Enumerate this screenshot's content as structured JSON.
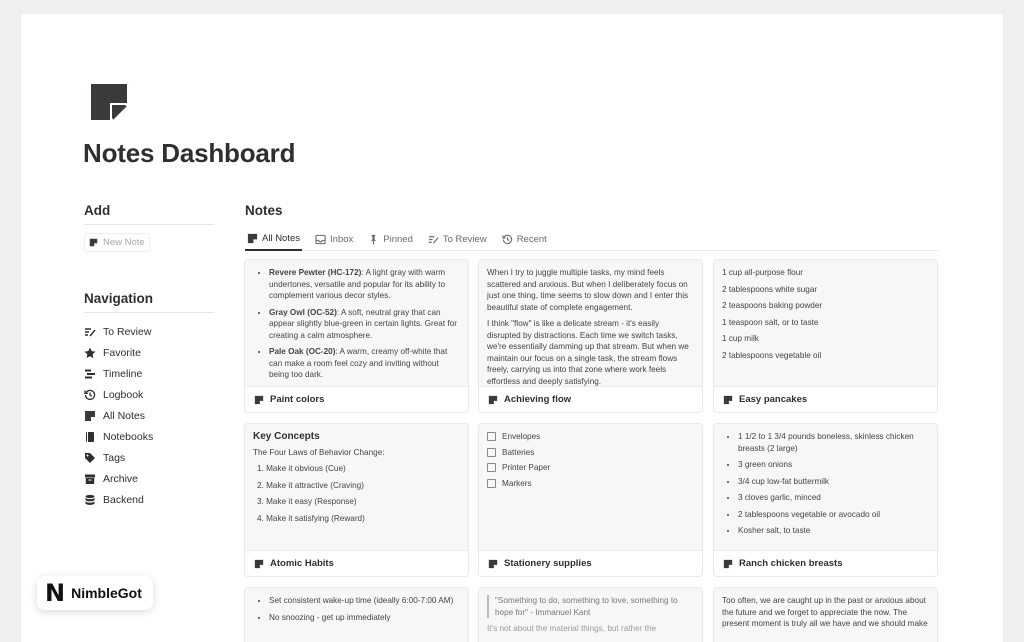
{
  "page": {
    "title": "Notes Dashboard"
  },
  "add_section": {
    "heading": "Add",
    "new_note": "New Note"
  },
  "navigation": {
    "heading": "Navigation",
    "items": [
      {
        "label": "To Review",
        "icon": "review-icon"
      },
      {
        "label": "Favorite",
        "icon": "star-icon"
      },
      {
        "label": "Timeline",
        "icon": "timeline-icon"
      },
      {
        "label": "Logbook",
        "icon": "history-icon"
      },
      {
        "label": "All Notes",
        "icon": "note-icon"
      },
      {
        "label": "Notebooks",
        "icon": "notebook-icon"
      },
      {
        "label": "Tags",
        "icon": "tag-icon"
      },
      {
        "label": "Archive",
        "icon": "archive-icon"
      },
      {
        "label": "Backend",
        "icon": "database-icon"
      }
    ]
  },
  "notes": {
    "heading": "Notes",
    "tabs": [
      {
        "label": "All Notes",
        "active": true
      },
      {
        "label": "Inbox",
        "active": false
      },
      {
        "label": "Pinned",
        "active": false
      },
      {
        "label": "To Review",
        "active": false
      },
      {
        "label": "Recent",
        "active": false
      }
    ],
    "cards": [
      {
        "title": "Paint colors",
        "bullets": [
          {
            "bold": "Revere Pewter (HC-172)",
            "text": ": A light gray with warm undertones, versatile and popular for its ability to complement various decor styles."
          },
          {
            "bold": "Gray Owl (OC-52)",
            "text": ": A soft, neutral gray that can appear slightly blue-green in certain lights. Great for creating a calm atmosphere."
          },
          {
            "bold": "Pale Oak (OC-20)",
            "text": ": A warm, creamy off-white that can make a room feel cozy and inviting without being too dark."
          }
        ]
      },
      {
        "title": "Achieving flow",
        "paragraphs": [
          "When I try to juggle multiple tasks, my mind feels scattered and anxious. But when I deliberately focus on just one thing, time seems to slow down and I enter this beautiful state of complete engagement.",
          "I think \"flow\" is like a delicate stream - it's easily disrupted by distractions. Each time we switch tasks, we're essentially damming up that stream. But when we maintain our focus on a single task, the stream flows freely, carrying us into that zone where work feels effortless and deeply satisfying."
        ]
      },
      {
        "title": "Easy pancakes",
        "lines": [
          "1 cup all-purpose flour",
          "2 tablespoons white sugar",
          "2 teaspoons baking powder",
          "1 teaspoon salt, or to taste",
          "1 cup milk",
          "2 tablespoons vegetable oil"
        ]
      },
      {
        "title": "Atomic Habits",
        "heading": "Key Concepts",
        "intro": "The Four Laws of Behavior Change:",
        "numbered": [
          "1.   Make it obvious (Cue)",
          "2.   Make it attractive (Craving)",
          "3.   Make it easy (Response)",
          "4.   Make it satisfying (Reward)"
        ]
      },
      {
        "title": "Stationery supplies",
        "checklist": [
          "Envelopes",
          "Batteries",
          "Printer Paper",
          "Markers"
        ]
      },
      {
        "title": "Ranch chicken breasts",
        "bullets": [
          "1 1/2 to 1 3/4 pounds boneless, skinless chicken breasts (2 large)",
          "3 green onions",
          "3/4 cup low-fat buttermilk",
          "3 cloves garlic, minced",
          "2 tablespoons vegetable or avocado oil",
          "Kosher salt, to taste"
        ]
      },
      {
        "bullets": [
          "Set consistent wake-up time (ideally 6:00-7:00 AM)",
          "No snoozing - get up immediately"
        ]
      },
      {
        "quote": "\"Something to do, something to love, something to hope for\" - Immanuel Kant",
        "text": "It's not about the material things, but rather the"
      },
      {
        "text": "Too often, we are caught up in the past or anxious about the future and we forget to appreciate the now. The present moment is truly all we have and we should make"
      }
    ]
  },
  "badge": {
    "text": "NimbleGot",
    "mark": "N"
  }
}
